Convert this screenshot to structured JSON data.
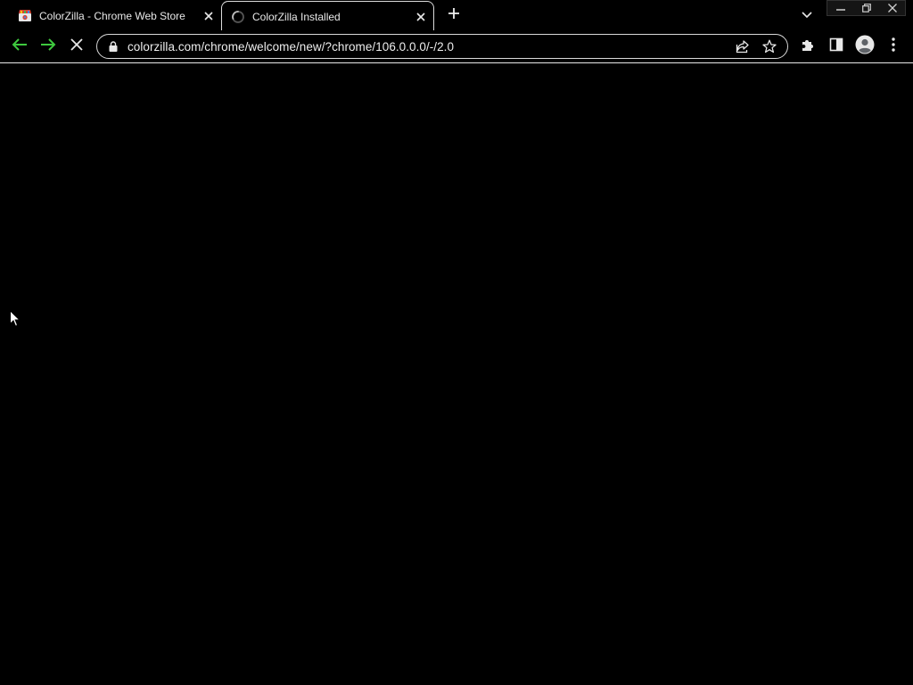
{
  "tabs": [
    {
      "title": "ColorZilla - Chrome Web Store",
      "favicon": "chrome-web-store-icon",
      "active": false
    },
    {
      "title": "ColorZilla Installed",
      "favicon": "loading-spinner-icon",
      "active": true
    }
  ],
  "omnibox": {
    "url": "colorzilla.com/chrome/welcome/new/?chrome/106.0.0.0/-/2.0",
    "secure_icon": "lock-icon"
  },
  "colors": {
    "background": "#000000",
    "nav_arrow": "#3ec93e",
    "text": "#e8e8e8"
  },
  "icons": {
    "back": "back-arrow-icon",
    "forward": "forward-arrow-icon",
    "stop": "stop-loading-icon",
    "share": "share-icon",
    "bookmark": "star-icon",
    "extensions": "puzzle-icon",
    "side_panel": "side-panel-icon",
    "profile": "profile-icon",
    "menu": "kebab-menu-icon",
    "new_tab": "plus-icon",
    "tab_search": "chevron-down-icon",
    "minimize": "minimize-icon",
    "restore": "restore-icon",
    "window_close": "close-icon"
  }
}
